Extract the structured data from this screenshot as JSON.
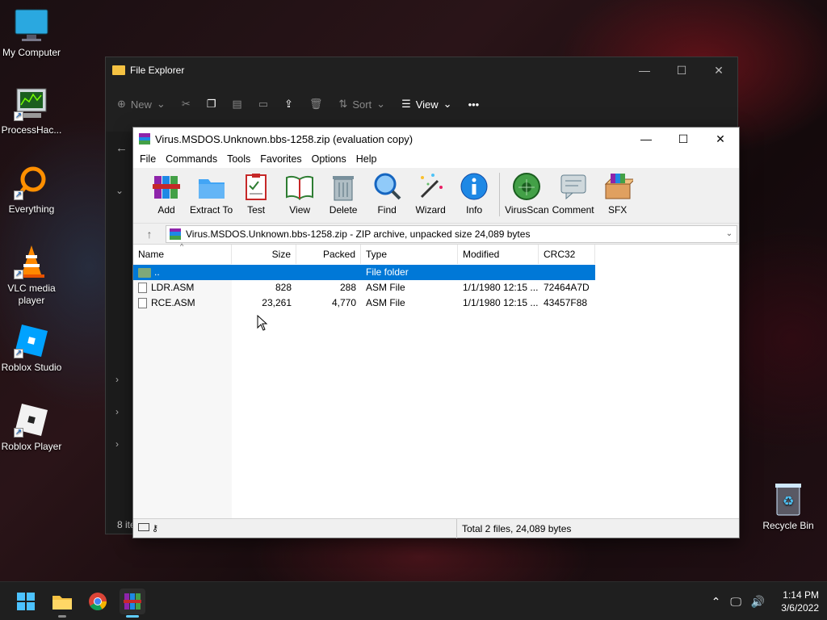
{
  "desktop": {
    "icons": [
      {
        "label": "My Computer",
        "icon": "monitor-icon"
      },
      {
        "label": "ProcessHac...",
        "icon": "process-hacker-icon"
      },
      {
        "label": "Everything",
        "icon": "everything-search-icon"
      },
      {
        "label": "VLC media player",
        "icon": "vlc-cone-icon"
      },
      {
        "label": "Roblox Studio",
        "icon": "roblox-studio-icon"
      },
      {
        "label": "Roblox Player",
        "icon": "roblox-player-icon"
      }
    ],
    "recycle_bin": {
      "label": "Recycle Bin",
      "icon": "recycle-bin-icon"
    }
  },
  "file_explorer": {
    "title": "File Explorer",
    "toolbar": {
      "new_label": "New",
      "sort_label": "Sort",
      "view_label": "View",
      "more_label": "•••"
    },
    "items_count": "8 ite"
  },
  "winrar": {
    "title": "Virus.MSDOS.Unknown.bbs-1258.zip (evaluation copy)",
    "menu": [
      "File",
      "Commands",
      "Tools",
      "Favorites",
      "Options",
      "Help"
    ],
    "toolbar": [
      {
        "label": "Add",
        "icon": "add-archive-icon"
      },
      {
        "label": "Extract To",
        "icon": "extract-folder-icon"
      },
      {
        "label": "Test",
        "icon": "test-clipboard-icon"
      },
      {
        "label": "View",
        "icon": "view-book-icon"
      },
      {
        "label": "Delete",
        "icon": "trash-icon"
      },
      {
        "label": "Find",
        "icon": "magnifier-icon"
      },
      {
        "label": "Wizard",
        "icon": "wizard-wand-icon"
      },
      {
        "label": "Info",
        "icon": "info-icon"
      },
      {
        "label": "VirusScan",
        "icon": "virus-scan-icon"
      },
      {
        "label": "Comment",
        "icon": "comment-icon"
      },
      {
        "label": "SFX",
        "icon": "sfx-box-icon"
      }
    ],
    "address": "Virus.MSDOS.Unknown.bbs-1258.zip - ZIP archive, unpacked size 24,089 bytes",
    "columns": {
      "name": "Name",
      "size": "Size",
      "packed": "Packed",
      "type": "Type",
      "modified": "Modified",
      "crc": "CRC32"
    },
    "rows": [
      {
        "name": "..",
        "size": "",
        "packed": "",
        "type": "File folder",
        "modified": "",
        "crc": "",
        "selected": true
      },
      {
        "name": "LDR.ASM",
        "size": "828",
        "packed": "288",
        "type": "ASM File",
        "modified": "1/1/1980 12:15 ...",
        "crc": "72464A7D",
        "selected": false
      },
      {
        "name": "RCE.ASM",
        "size": "23,261",
        "packed": "4,770",
        "type": "ASM File",
        "modified": "1/1/1980 12:15 ...",
        "crc": "43457F88",
        "selected": false
      }
    ],
    "status": "Total 2 files, 24,089 bytes"
  },
  "taskbar": {
    "apps": [
      "start-windows-icon",
      "file-explorer-icon",
      "chrome-icon",
      "winrar-icon"
    ],
    "clock_time": "1:14 PM",
    "clock_date": "3/6/2022"
  },
  "colors": {
    "selection": "#0078d7",
    "taskbar": "#1f1f1f",
    "accent": "#60cdff"
  }
}
